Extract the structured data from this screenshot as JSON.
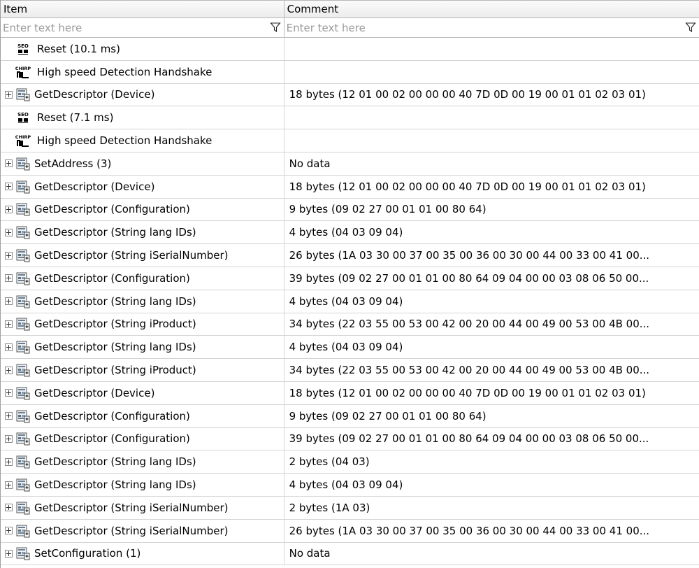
{
  "columns": {
    "item": "Item",
    "comment": "Comment"
  },
  "filters": {
    "item_placeholder": "Enter text here",
    "comment_placeholder": "Enter text here"
  },
  "rows": [
    {
      "icon": "seo-icon",
      "expandable": false,
      "item": "Reset (10.1 ms)",
      "comment": ""
    },
    {
      "icon": "chirp-icon",
      "expandable": false,
      "item": "High speed Detection Handshake",
      "comment": ""
    },
    {
      "icon": "transfer-icon",
      "expandable": true,
      "item": "GetDescriptor (Device)",
      "comment": "18 bytes (12 01 00 02 00 00 00 40 7D 0D 00 19 00 01 01 02 03 01)"
    },
    {
      "icon": "seo-icon",
      "expandable": false,
      "item": "Reset (7.1 ms)",
      "comment": ""
    },
    {
      "icon": "chirp-icon",
      "expandable": false,
      "item": "High speed Detection Handshake",
      "comment": ""
    },
    {
      "icon": "transfer-icon",
      "expandable": true,
      "item": "SetAddress (3)",
      "comment": "No data"
    },
    {
      "icon": "transfer-icon",
      "expandable": true,
      "item": "GetDescriptor (Device)",
      "comment": "18 bytes (12 01 00 02 00 00 00 40 7D 0D 00 19 00 01 01 02 03 01)"
    },
    {
      "icon": "transfer-icon",
      "expandable": true,
      "item": "GetDescriptor (Configuration)",
      "comment": "9 bytes (09 02 27 00 01 01 00 80 64)"
    },
    {
      "icon": "transfer-icon",
      "expandable": true,
      "item": "GetDescriptor (String lang IDs)",
      "comment": "4 bytes (04 03 09 04)"
    },
    {
      "icon": "transfer-icon",
      "expandable": true,
      "item": "GetDescriptor (String iSerialNumber)",
      "comment": "26 bytes (1A 03 30 00 37 00 35 00 36 00 30 00 44 00 33 00 41 00..."
    },
    {
      "icon": "transfer-icon",
      "expandable": true,
      "item": "GetDescriptor (Configuration)",
      "comment": "39 bytes (09 02 27 00 01 01 00 80 64 09 04 00 00 03 08 06 50 00..."
    },
    {
      "icon": "transfer-icon",
      "expandable": true,
      "item": "GetDescriptor (String lang IDs)",
      "comment": "4 bytes (04 03 09 04)"
    },
    {
      "icon": "transfer-icon",
      "expandable": true,
      "item": "GetDescriptor (String iProduct)",
      "comment": "34 bytes (22 03 55 00 53 00 42 00 20 00 44 00 49 00 53 00 4B 00..."
    },
    {
      "icon": "transfer-icon",
      "expandable": true,
      "item": "GetDescriptor (String lang IDs)",
      "comment": "4 bytes (04 03 09 04)"
    },
    {
      "icon": "transfer-icon",
      "expandable": true,
      "item": "GetDescriptor (String iProduct)",
      "comment": "34 bytes (22 03 55 00 53 00 42 00 20 00 44 00 49 00 53 00 4B 00..."
    },
    {
      "icon": "transfer-icon",
      "expandable": true,
      "item": "GetDescriptor (Device)",
      "comment": "18 bytes (12 01 00 02 00 00 00 40 7D 0D 00 19 00 01 01 02 03 01)"
    },
    {
      "icon": "transfer-icon",
      "expandable": true,
      "item": "GetDescriptor (Configuration)",
      "comment": "9 bytes (09 02 27 00 01 01 00 80 64)"
    },
    {
      "icon": "transfer-icon",
      "expandable": true,
      "item": "GetDescriptor (Configuration)",
      "comment": "39 bytes (09 02 27 00 01 01 00 80 64 09 04 00 00 03 08 06 50 00..."
    },
    {
      "icon": "transfer-icon",
      "expandable": true,
      "item": "GetDescriptor (String lang IDs)",
      "comment": "2 bytes (04 03)"
    },
    {
      "icon": "transfer-icon",
      "expandable": true,
      "item": "GetDescriptor (String lang IDs)",
      "comment": "4 bytes (04 03 09 04)"
    },
    {
      "icon": "transfer-icon",
      "expandable": true,
      "item": "GetDescriptor (String iSerialNumber)",
      "comment": "2 bytes (1A 03)"
    },
    {
      "icon": "transfer-icon",
      "expandable": true,
      "item": "GetDescriptor (String iSerialNumber)",
      "comment": "26 bytes (1A 03 30 00 37 00 35 00 36 00 30 00 44 00 33 00 41 00..."
    },
    {
      "icon": "transfer-icon",
      "expandable": true,
      "item": "SetConfiguration (1)",
      "comment": "No data"
    }
  ]
}
